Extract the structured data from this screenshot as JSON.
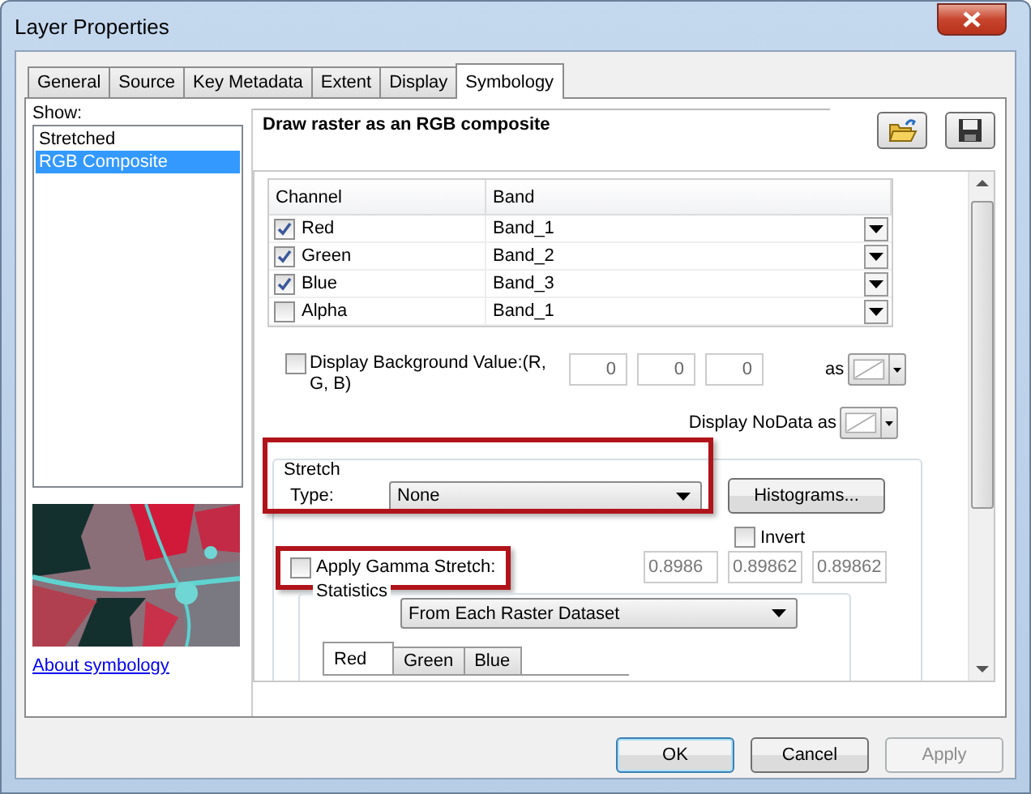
{
  "window": {
    "title": "Layer Properties"
  },
  "tabs": [
    {
      "label": "General",
      "selected": false
    },
    {
      "label": "Source",
      "selected": false
    },
    {
      "label": "Key Metadata",
      "selected": false
    },
    {
      "label": "Extent",
      "selected": false
    },
    {
      "label": "Display",
      "selected": false
    },
    {
      "label": "Symbology",
      "selected": true
    }
  ],
  "show": {
    "label": "Show:",
    "items": [
      {
        "label": "Stretched",
        "selected": false
      },
      {
        "label": "RGB Composite",
        "selected": true
      }
    ],
    "link": "About symbology"
  },
  "heading": "Draw raster as an RGB composite",
  "table": {
    "columns": [
      "Channel",
      "Band"
    ],
    "rows": [
      {
        "channel": "Red",
        "checked": true,
        "band": "Band_1"
      },
      {
        "channel": "Green",
        "checked": true,
        "band": "Band_2"
      },
      {
        "channel": "Blue",
        "checked": true,
        "band": "Band_3"
      },
      {
        "channel": "Alpha",
        "checked": false,
        "band": "Band_1"
      }
    ]
  },
  "background": {
    "label": "Display Background Value:(R, G, B)",
    "checked": false,
    "values": [
      "0",
      "0",
      "0"
    ],
    "as_label": "as"
  },
  "nodata": {
    "label": "Display NoData as"
  },
  "stretch": {
    "title": "Stretch",
    "type_label": "Type:",
    "type_value": "None",
    "highlighted": true,
    "histograms": "Histograms...",
    "invert": {
      "label": "Invert",
      "checked": false
    }
  },
  "gamma": {
    "label": "Apply Gamma Stretch:",
    "checked": false,
    "highlighted": true,
    "values": [
      "0.8986",
      "0.89862",
      "0.89862"
    ]
  },
  "statistics": {
    "title": "Statistics",
    "value": "From Each Raster Dataset",
    "tabs": [
      {
        "label": "Red",
        "selected": true
      },
      {
        "label": "Green",
        "selected": false
      },
      {
        "label": "Blue",
        "selected": false
      }
    ]
  },
  "buttons": [
    {
      "label": "OK",
      "kind": "default",
      "disabled": false
    },
    {
      "label": "Cancel",
      "kind": "normal",
      "disabled": false
    },
    {
      "label": "Apply",
      "kind": "normal",
      "disabled": true
    }
  ]
}
